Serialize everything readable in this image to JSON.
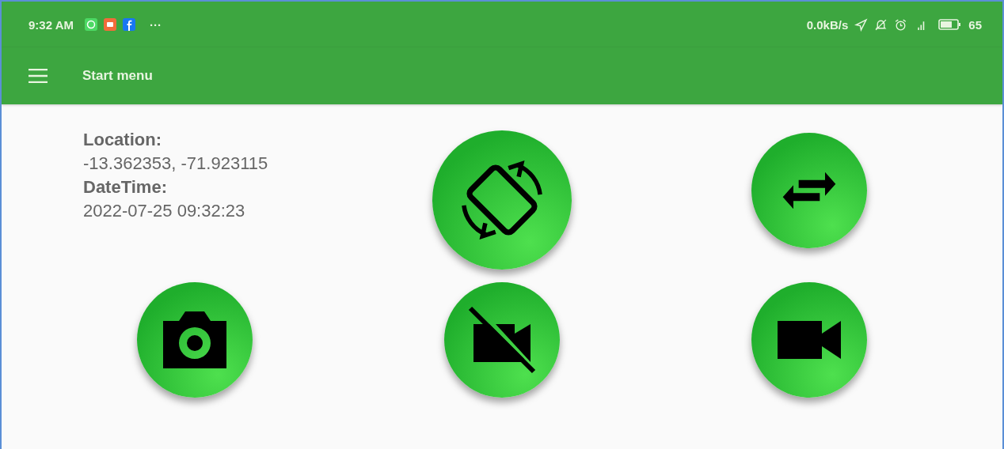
{
  "status_bar": {
    "time": "9:32 AM",
    "more": "···",
    "speed": "0.0kB/s",
    "battery": "65"
  },
  "app_bar": {
    "title": "Start menu"
  },
  "info": [
    {
      "label": "Location:",
      "value": "-13.362353, -71.923115"
    },
    {
      "label": "DateTime:",
      "value": "2022-07-25 09:32:23"
    }
  ],
  "buttons": [
    {
      "kind": "rotate"
    },
    {
      "kind": "swap"
    },
    {
      "kind": "camera"
    },
    {
      "kind": "video-off"
    },
    {
      "kind": "video"
    }
  ]
}
